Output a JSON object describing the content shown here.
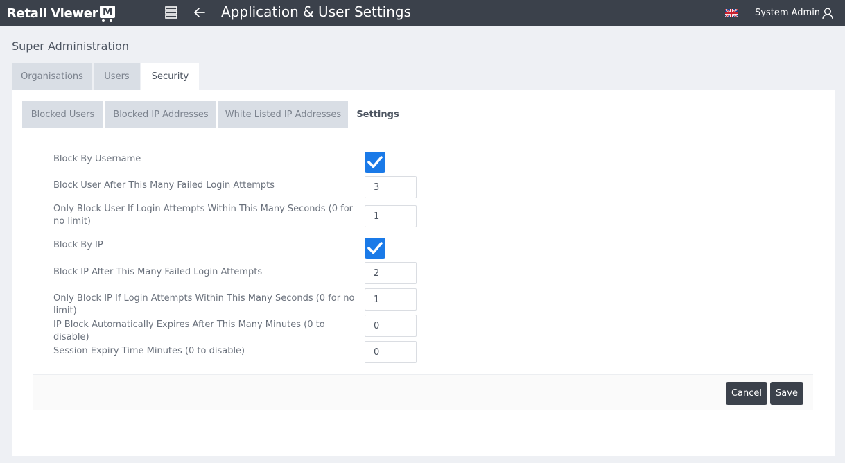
{
  "app": {
    "logo_text": "Retail Viewer",
    "logo_badge": "M",
    "title": "Application & User Settings",
    "user_name": "System Admin"
  },
  "icons": {
    "menu": "menu-stack-icon",
    "back": "arrow-left-icon",
    "language": "uk-flag-icon",
    "user": "user-outline-icon"
  },
  "section_title": "Super Administration",
  "main_tabs": [
    {
      "label": "Organisations"
    },
    {
      "label": "Users"
    },
    {
      "label": "Security"
    }
  ],
  "sub_tabs": [
    {
      "label": "Blocked Users"
    },
    {
      "label": "Blocked IP Addresses"
    },
    {
      "label": "White Listed IP Addresses"
    },
    {
      "label": "Settings"
    }
  ],
  "settings": {
    "block_by_username": {
      "label": "Block By Username",
      "checked": true
    },
    "user_failed_attempts": {
      "label": "Block User After This Many Failed Login Attempts",
      "value": "3"
    },
    "user_attempt_window": {
      "label": "Only Block User If Login Attempts Within This Many Seconds (0 for no limit)",
      "value": "1"
    },
    "block_by_ip": {
      "label": "Block By IP",
      "checked": true
    },
    "ip_failed_attempts": {
      "label": "Block IP After This Many Failed Login Attempts",
      "value": "2"
    },
    "ip_attempt_window": {
      "label": "Only Block IP If Login Attempts Within This Many Seconds (0 for no limit)",
      "value": "1"
    },
    "ip_block_expiry": {
      "label": "IP Block Automatically Expires After This Many Minutes (0 to disable)",
      "value": "0"
    },
    "session_expiry": {
      "label": "Session Expiry Time Minutes (0 to disable)",
      "value": "0"
    }
  },
  "buttons": {
    "cancel": "Cancel",
    "save": "Save"
  },
  "colors": {
    "topbar": "#3b414b",
    "accent": "#1a7ae8",
    "tab_inactive": "#d9dee5"
  }
}
